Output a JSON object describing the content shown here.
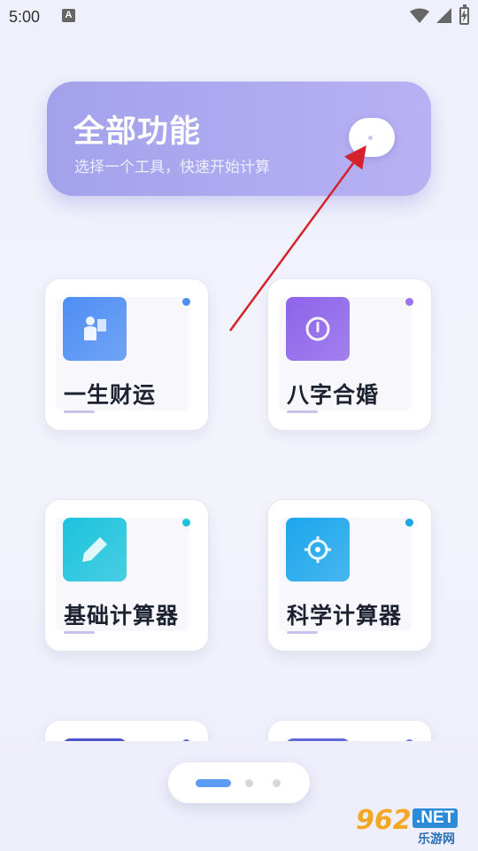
{
  "status_bar": {
    "time": "5:00",
    "notification_icon": "A"
  },
  "header": {
    "title": "全部功能",
    "subtitle": "选择一个工具，快速开始计算",
    "toggle_icon": "toggle-icon"
  },
  "tools": [
    {
      "label": "一生财运",
      "icon": "person-flag-icon",
      "color": "#4e8ef4",
      "dot_color": "#4e8ef4"
    },
    {
      "label": "八字合婚",
      "icon": "power-icon",
      "color": "#8d63ea",
      "dot_color": "#9b74ee"
    },
    {
      "label": "基础计算器",
      "icon": "pencil-icon",
      "color": "#1cc3dd",
      "dot_color": "#1cc3dd"
    },
    {
      "label": "科学计算器",
      "icon": "target-icon",
      "color": "#1ba6ec",
      "dot_color": "#1ba6ec"
    }
  ],
  "partial_tools": [
    {
      "color": "#4e54c8",
      "dot_color": "#5a5fd0"
    },
    {
      "color": "#5d6ad8",
      "dot_color": "#6b74de"
    }
  ],
  "page_indicator": {
    "count": 3,
    "active": 0
  },
  "watermark": {
    "num": "962",
    "net": ".NET",
    "cn": "乐游网"
  }
}
